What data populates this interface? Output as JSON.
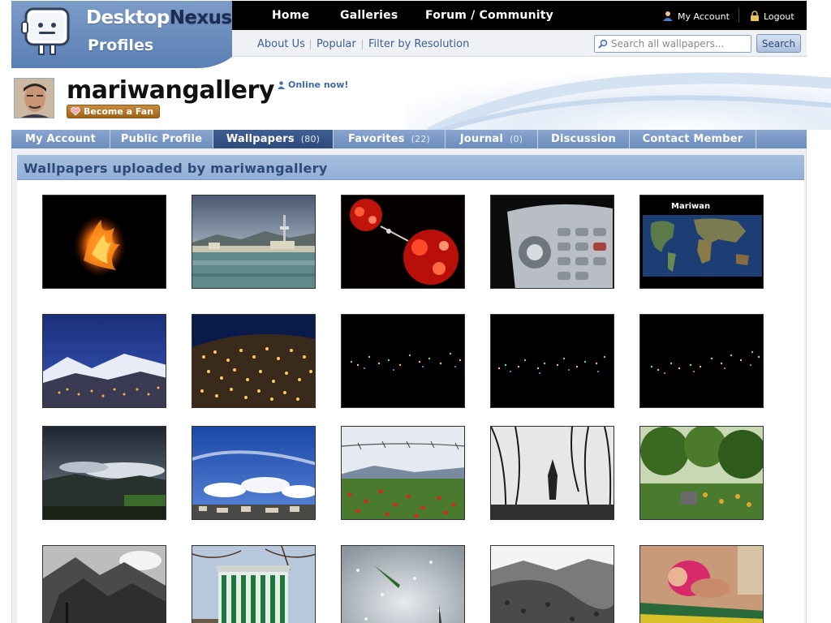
{
  "site": {
    "logo_part1": "Desktop",
    "logo_part2": "Nexus",
    "logo_tm": "™",
    "logo_sub": "Profiles"
  },
  "nav": {
    "home": "Home",
    "galleries": "Galleries",
    "forum": "Forum / Community",
    "my_account": "My Account",
    "logout": "Logout"
  },
  "subnav": {
    "about": "About Us",
    "popular": "Popular",
    "filter": "Filter by Resolution",
    "search_placeholder": "Search all wallpapers...",
    "search_button": "Search"
  },
  "profile": {
    "username": "mariwangallery",
    "online": "Online now!",
    "fan_button": "Become a Fan"
  },
  "tabs": [
    {
      "label": "My Account",
      "count": ""
    },
    {
      "label": "Public Profile",
      "count": ""
    },
    {
      "label": "Wallpapers",
      "count": "(80)"
    },
    {
      "label": "Favorites",
      "count": "(22)"
    },
    {
      "label": "Journal",
      "count": "(0)"
    },
    {
      "label": "Discussion",
      "count": ""
    },
    {
      "label": "Contact Member",
      "count": ""
    }
  ],
  "section": {
    "title": "Wallpapers uploaded by mariwangallery"
  },
  "wallpapers": [
    {
      "theme": "fire"
    },
    {
      "theme": "lake-city"
    },
    {
      "theme": "red-crystals"
    },
    {
      "theme": "phone-keypad"
    },
    {
      "theme": "world-map",
      "caption": "Mariwan"
    },
    {
      "theme": "blue-mountain-lights"
    },
    {
      "theme": "hillside-city-lights"
    },
    {
      "theme": "night-lights-1"
    },
    {
      "theme": "night-lights-2"
    },
    {
      "theme": "night-lights-3"
    },
    {
      "theme": "dark-clouds-valley"
    },
    {
      "theme": "blue-sky-clouds"
    },
    {
      "theme": "barbed-wire-field"
    },
    {
      "theme": "bw-tree-statue"
    },
    {
      "theme": "green-park"
    },
    {
      "theme": "bw-rocky-mountain"
    },
    {
      "theme": "tall-building"
    },
    {
      "theme": "snow-closeup"
    },
    {
      "theme": "bw-hills"
    },
    {
      "theme": "sleeping-baby"
    }
  ],
  "colors": {
    "brand_blue": "#5a7fb4",
    "tab_bg": "#7896c4",
    "tab_active": "#2c4a7a",
    "link": "#3b5f93",
    "fan_button": "#b0732a"
  }
}
